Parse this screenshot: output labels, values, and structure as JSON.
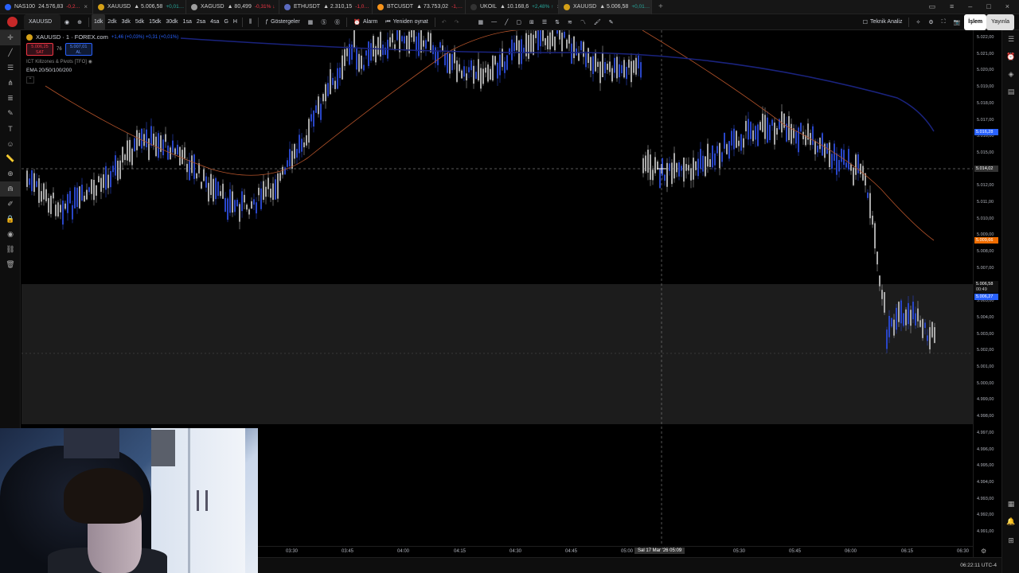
{
  "tabs": [
    {
      "symbol": "NAS100",
      "price": "24.576,83",
      "change": "-0,2…",
      "change_color": "#f23645",
      "dot_color": "#2962ff"
    },
    {
      "symbol": "XAUUSD",
      "price": "▲ 5.006,58",
      "change": "+0,01…",
      "change_color": "#26a69a",
      "dot_color": "#d4a017"
    },
    {
      "symbol": "XAGUSD",
      "price": "▲ 80,499",
      "change": "-0,31% ↓",
      "change_color": "#f23645",
      "dot_color": "#9e9e9e"
    },
    {
      "symbol": "ETHUSDT",
      "price": "▲ 2.310,15",
      "change": "-1,0…",
      "change_color": "#f23645",
      "dot_color": "#5c6bc0"
    },
    {
      "symbol": "BTCUSDT",
      "price": "▲ 73.753,02",
      "change": "-1,…",
      "change_color": "#f23645",
      "dot_color": "#f7931a"
    },
    {
      "symbol": "UKOIL",
      "price": "▲ 10.168,6",
      "change": "+2,48% ↑",
      "change_color": "#26a69a",
      "dot_color": "#222222"
    },
    {
      "symbol": "XAUUSD",
      "price": "▲ 5.006,58",
      "change": "+0,01…",
      "change_color": "#26a69a",
      "dot_color": "#d4a017",
      "active": true
    }
  ],
  "toolbar": {
    "symbol": "XAUUSD",
    "timeframes": [
      "1dk",
      "2dk",
      "3dk",
      "5dk",
      "15dk",
      "30dk",
      "1sa",
      "2sa",
      "4sa",
      "G",
      "H"
    ],
    "indicators_label": "Göstergeler",
    "alarm_label": "Alarm",
    "replay_label": "Yeniden oynat",
    "tech_label": "Teknik Analiz",
    "trade_label": "İşlem",
    "publish_label": "Yayınla"
  },
  "legend": {
    "title": "XAUUSD · 1 · FOREX.com",
    "change": "+1,46 (+0,03%) +0,31 (+0,01%)",
    "sell_price": "5.006,25",
    "sell_label": "SAT",
    "spread": "76",
    "buy_price": "5.007,01",
    "buy_label": "AL",
    "indicator1": "ICT Killzones & Pivots [TFO]",
    "indicator2": "EMA 20/50/100/200"
  },
  "price_axis": {
    "labels": [
      "5.022,00",
      "5.021,00",
      "5.020,00",
      "5.019,00",
      "5.018,00",
      "5.017,00",
      "5.016,00",
      "5.015,00",
      "5.013,00",
      "5.012,00",
      "5.011,00",
      "5.010,00",
      "5.009,00",
      "5.008,00",
      "5.007,00",
      "5.006,00",
      "5.005,00",
      "5.004,00",
      "5.003,00",
      "5.002,00",
      "5.001,00",
      "5.000,00",
      "4.999,00",
      "4.998,00",
      "4.997,00",
      "4.996,00",
      "4.995,00",
      "4.994,00",
      "4.993,00",
      "4.992,00",
      "4.991,00"
    ],
    "tag_blue": "5.016,28",
    "tag_cursor": "5.014,02",
    "tag_orange": "5.009,66",
    "tag_price": "5.006,58",
    "tag_timer": "00:49",
    "tag_blue2": "5.006,27"
  },
  "time_axis": {
    "labels": [
      "03:30",
      "03:45",
      "04:00",
      "04:15",
      "04:30",
      "04:45",
      "05:00",
      "05:30",
      "05:45",
      "06:00",
      "06:15",
      "06:30"
    ],
    "cursor": "Sal 17 Mar '26   05:09"
  },
  "status": {
    "clock": "06:22:11 UTC-4"
  }
}
